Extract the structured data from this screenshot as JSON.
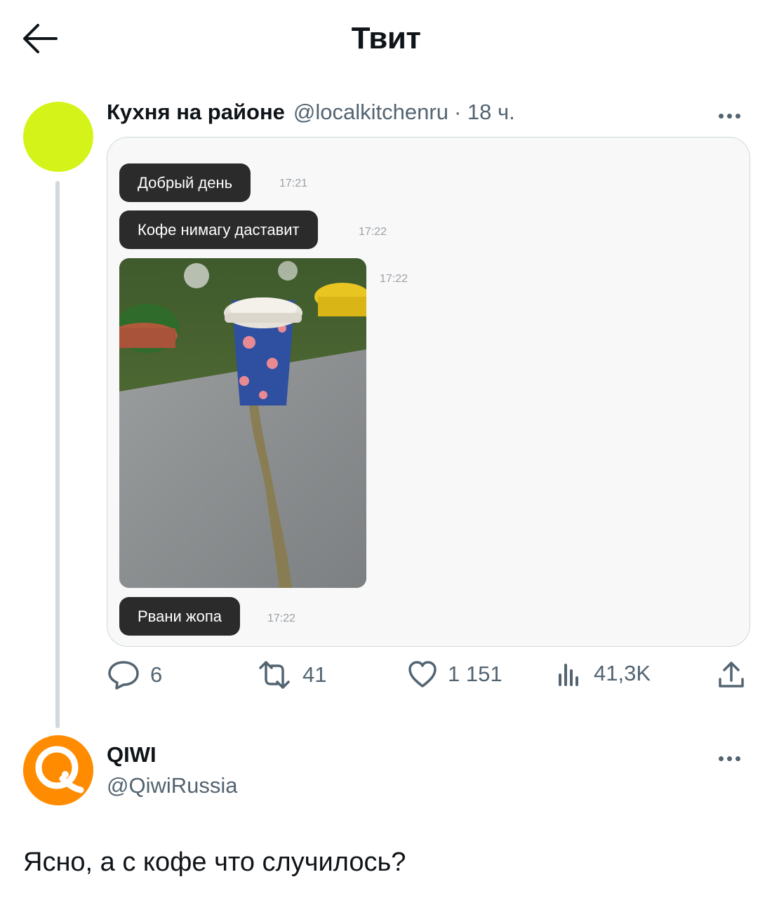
{
  "header": {
    "title": "Твит"
  },
  "tweet": {
    "author_name": "Кухня на районе",
    "author_handle": "@localkitchenru",
    "time": "· 18 ч.",
    "avatar_color": "#d4f419",
    "chat": {
      "messages": [
        {
          "text": "Добрый день",
          "time": "17:21"
        },
        {
          "text": "Кофе нимагу даставит",
          "time": "17:22"
        },
        {
          "text": "Рвани жопа",
          "time": "17:22"
        }
      ],
      "photo_time": "17:22"
    },
    "stats": {
      "replies": "6",
      "retweets": "41",
      "likes": "1 151",
      "views": "41,3K"
    }
  },
  "reply": {
    "author_name": "QIWI",
    "author_handle": "@QiwiRussia",
    "avatar_color": "#ff8c00",
    "text": "Ясно, а с кофе что случилось?"
  }
}
